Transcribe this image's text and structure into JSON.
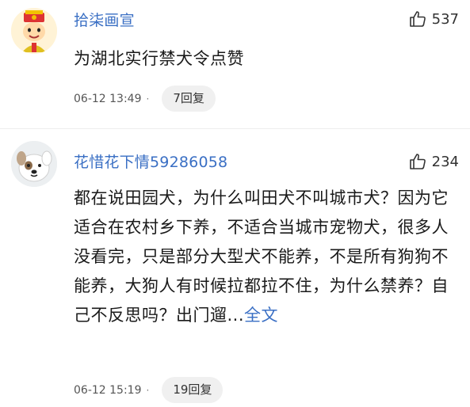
{
  "comments": [
    {
      "user": "拾柒画宣",
      "likes": "537",
      "text": "为湖北实行禁犬令点赞",
      "time": "06-12 13:49",
      "replies": "7回复",
      "avatar_icon": "emperor-cartoon-avatar"
    },
    {
      "user": "花惜花下情59286058",
      "likes": "234",
      "text": "都在说田园犬，为什么叫田犬不叫城市犬？因为它适合在农村乡下养，不适合当城市宠物犬，很多人没看完，只是部分大型犬不能养，不是所有狗狗不能养，大狗人有时候拉都拉不住，为什么禁养？自己不反思吗？出门遛...",
      "more": "全文",
      "time": "06-12 15:19",
      "replies": "19回复",
      "avatar_icon": "dog-cartoon-avatar"
    }
  ],
  "icons": {
    "like": "thumbs-up-icon"
  },
  "colors": {
    "username": "#3a6fc4",
    "link": "#3a6fc4",
    "pill": "#f0f0f0"
  }
}
